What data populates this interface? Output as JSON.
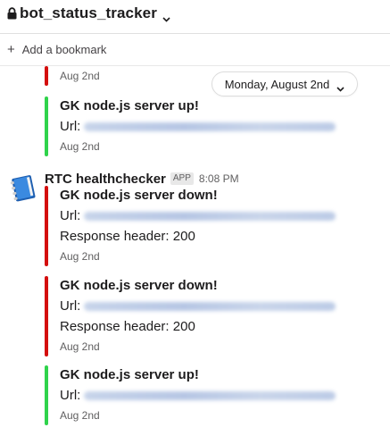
{
  "header": {
    "channel_name": "bot_status_tracker"
  },
  "bookmarks": {
    "add_label": "Add a bookmark"
  },
  "divider": {
    "date_label": "Monday, August 2nd"
  },
  "top_fragment": {
    "date": "Aug 2nd"
  },
  "first_attachment": {
    "title": "GK node.js server up!",
    "url_label": "Url:",
    "date": "Aug 2nd"
  },
  "message": {
    "sender": "RTC healthchecker",
    "badge": "APP",
    "time": "8:08 PM"
  },
  "attachments": [
    {
      "status": "down",
      "title": "GK node.js server down!",
      "url_label": "Url:",
      "response_label": "Response header: 200",
      "date": "Aug 2nd"
    },
    {
      "status": "down",
      "title": "GK node.js server down!",
      "url_label": "Url:",
      "response_label": "Response header: 200",
      "date": "Aug 2nd"
    },
    {
      "status": "up",
      "title": "GK node.js server up!",
      "url_label": "Url:",
      "date": "Aug 2nd"
    }
  ],
  "colors": {
    "down": "#d40e0d",
    "up": "#2fd34b"
  },
  "icons": {
    "channel": "lock-icon",
    "menu": "chevron-down-icon",
    "bookmark": "plus-icon",
    "avatar": "notebook-icon"
  }
}
